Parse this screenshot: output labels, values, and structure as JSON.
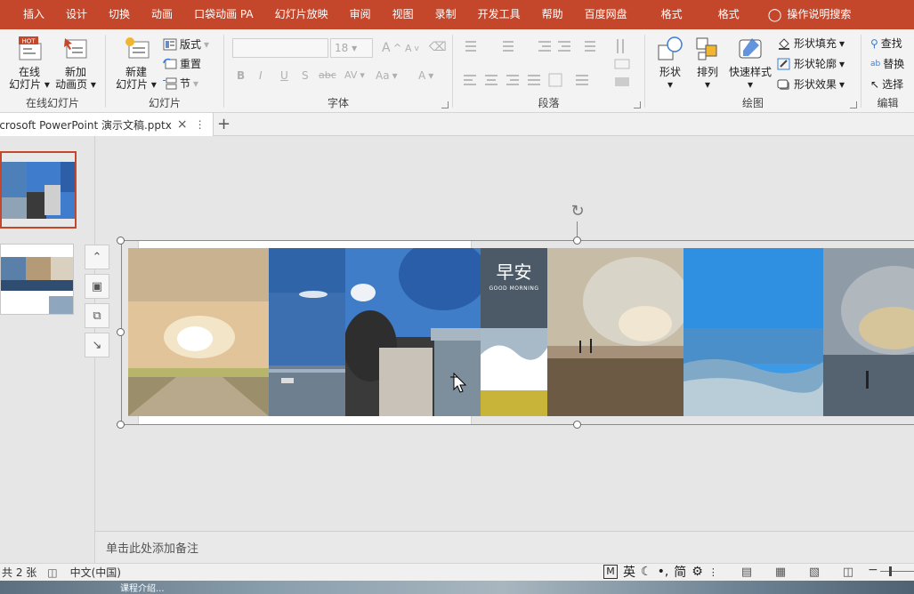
{
  "ribbon_tabs": [
    "插入",
    "设计",
    "切换",
    "动画",
    "口袋动画 PA",
    "幻灯片放映",
    "审阅",
    "视图",
    "录制",
    "开发工具",
    "帮助",
    "百度网盘",
    "格式",
    "格式",
    "操作说明搜索"
  ],
  "groups": {
    "online": {
      "label": "在线幻灯片",
      "btn1": "在线\n幻灯片",
      "btn1a": "在线",
      "btn1b": "幻灯片",
      "btn2a": "新加",
      "btn2b": "动画页",
      "hot": "HOT"
    },
    "slides": {
      "label": "幻灯片",
      "new_a": "新建",
      "new_b": "幻灯片",
      "layout": "版式",
      "reset": "重置",
      "section": "节"
    },
    "font": {
      "label": "字体",
      "size": "18",
      "bold": "B",
      "italic": "I",
      "underline": "U",
      "shadow": "S",
      "strike": "abc",
      "spacing": "AV",
      "case": "Aa",
      "color": "A",
      "grow": "A",
      "shrink": "A"
    },
    "paragraph": {
      "label": "段落"
    },
    "drawing": {
      "label": "绘图",
      "shape": "形状",
      "arrange": "排列",
      "quick": "快速样式",
      "fill": "形状填充",
      "outline": "形状轮廓",
      "effect": "形状效果"
    },
    "editing": {
      "label": "编辑",
      "find": "查找",
      "replace": "替换",
      "select": "选择"
    }
  },
  "doc_tab": {
    "title": "icrosoft PowerPoint 演示文稿.pptx"
  },
  "slide_text": {
    "zaoan": "早安",
    "goodmorning": "GOOD MORNING"
  },
  "notes_placeholder": "单击此处添加备注",
  "status": {
    "slide_count": "共 2 张",
    "language": "中文(中国)"
  },
  "ime": {
    "mode": "M",
    "lang": "英",
    "simp": "简"
  },
  "taskbar": {
    "text": "课程介绍..."
  },
  "colors": {
    "accent": "#c4472b",
    "ribbon": "#f3f3f3"
  }
}
